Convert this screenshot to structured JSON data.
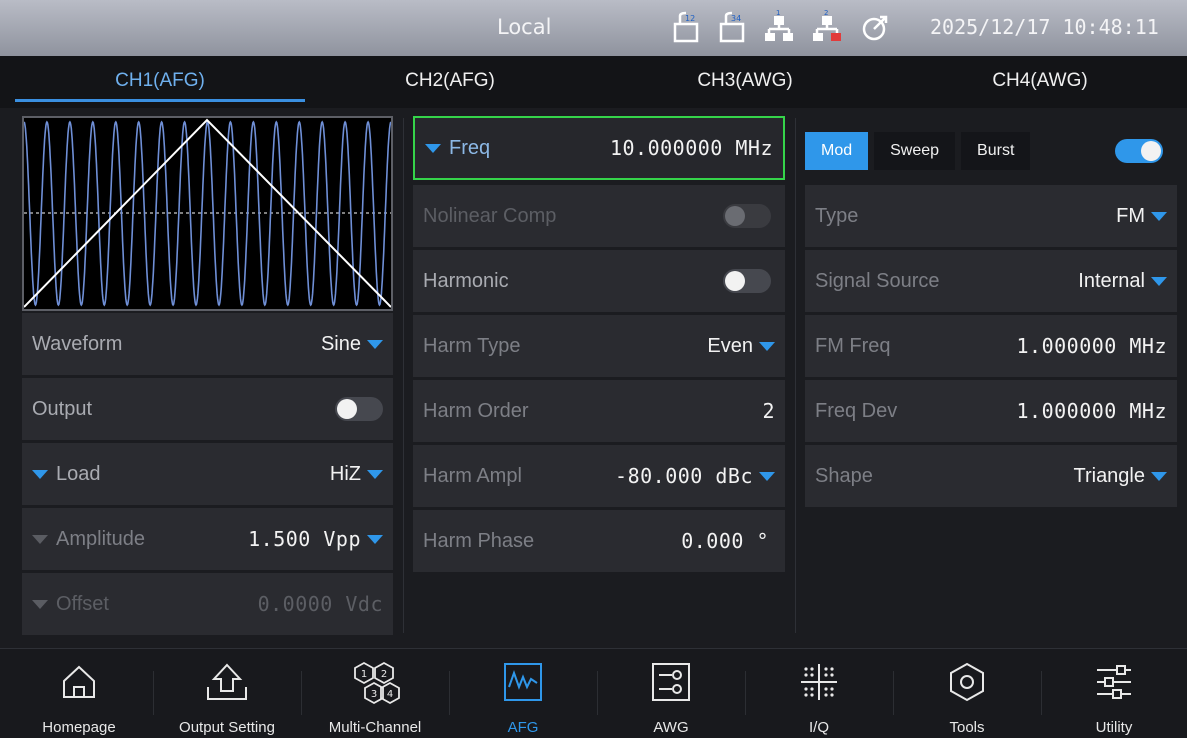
{
  "status": {
    "mode": "Local",
    "icons": [
      "usb-12-icon",
      "usb-34-icon",
      "network-1-icon",
      "network-2-disconnected-icon",
      "refresh-icon"
    ],
    "usb_labels": [
      "12",
      "34"
    ],
    "net_labels": [
      "1",
      "2"
    ],
    "datetime": "2025/12/17 10:48:11"
  },
  "tabs": [
    "CH1(AFG)",
    "CH2(AFG)",
    "CH3(AWG)",
    "CH4(AWG)"
  ],
  "active_tab": 0,
  "left": {
    "waveform": {
      "label": "Waveform",
      "value": "Sine"
    },
    "output": {
      "label": "Output",
      "on": false
    },
    "load": {
      "label": "Load",
      "value": "HiZ"
    },
    "amplitude": {
      "label": "Amplitude",
      "value": "1.500 Vpp"
    },
    "offset": {
      "label": "Offset",
      "value": "0.0000 Vdc"
    }
  },
  "middle": {
    "freq": {
      "label": "Freq",
      "value": "10.000000 MHz"
    },
    "nolinear": {
      "label": "Nolinear Comp",
      "on": false
    },
    "harmonic": {
      "label": "Harmonic",
      "on": false
    },
    "harm_type": {
      "label": "Harm Type",
      "value": "Even"
    },
    "harm_order": {
      "label": "Harm Order",
      "value": "2"
    },
    "harm_ampl": {
      "label": "Harm Ampl",
      "value": "-80.000 dBc"
    },
    "harm_phase": {
      "label": "Harm Phase",
      "value": "0.000 °"
    }
  },
  "right": {
    "segments": [
      "Mod",
      "Sweep",
      "Burst"
    ],
    "selected_segment": "Mod",
    "enable_on": true,
    "type": {
      "label": "Type",
      "value": "FM"
    },
    "source": {
      "label": "Signal Source",
      "value": "Internal"
    },
    "fm_freq": {
      "label": "FM Freq",
      "value": "1.000000 MHz"
    },
    "freq_dev": {
      "label": "Freq Dev",
      "value": "1.000000 MHz"
    },
    "shape": {
      "label": "Shape",
      "value": "Triangle"
    }
  },
  "nav": [
    {
      "label": "Homepage",
      "icon": "home-icon"
    },
    {
      "label": "Output Setting",
      "icon": "output-setting-icon"
    },
    {
      "label": "Multi-Channel",
      "icon": "multi-channel-icon"
    },
    {
      "label": "AFG",
      "icon": "afg-waveform-icon"
    },
    {
      "label": "AWG",
      "icon": "awg-icon"
    },
    {
      "label": "I/Q",
      "icon": "iq-constellation-icon"
    },
    {
      "label": "Tools",
      "icon": "tools-hexagon-icon"
    },
    {
      "label": "Utility",
      "icon": "utility-sliders-icon"
    }
  ],
  "active_nav": "AFG",
  "multi_channel_numbers": [
    "1",
    "2",
    "3",
    "4"
  ],
  "colors": {
    "accent": "#2f97ea",
    "focus": "#35d44a",
    "tab_active": "#6fb0ee",
    "wave": "#6f8fd6"
  }
}
